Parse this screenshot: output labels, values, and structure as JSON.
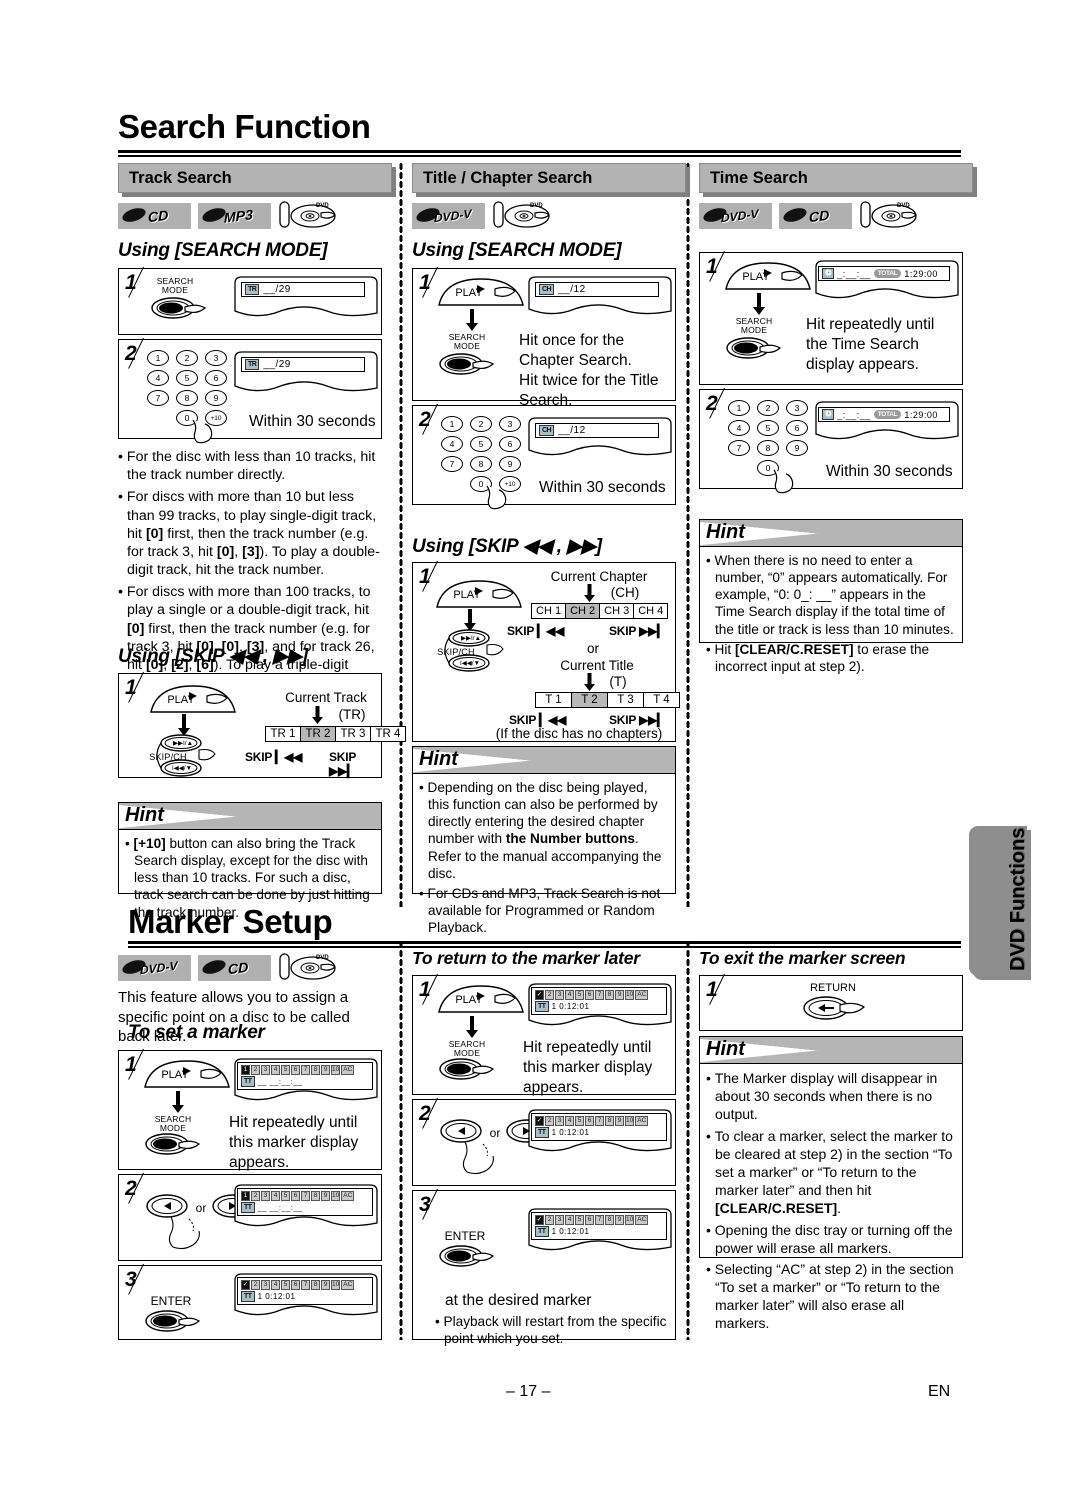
{
  "page": {
    "main_title": "Search Function",
    "second_title": "Marker Setup",
    "page_number": "– 17 –",
    "language_code": "EN",
    "side_tab": "DVD Functions"
  },
  "hint_label": "Hint",
  "track_search": {
    "section_title": "Track Search",
    "badges": [
      "CD",
      "MP3"
    ],
    "disc_icon": "dvd-disc-icon",
    "heading_search_mode": "Using [SEARCH MODE]",
    "heading_skip": "Using [SKIP ◀◀ , ▶▶]",
    "step1": {
      "number": "1",
      "button_label": "SEARCH\nMODE",
      "display_tag": "TR",
      "display_value": "__/29"
    },
    "step2": {
      "number": "2",
      "keys": [
        "1",
        "2",
        "3",
        "4",
        "5",
        "6",
        "7",
        "8",
        "9",
        "0",
        "+10"
      ],
      "display_tag": "TR",
      "display_value": "__/29",
      "caption": "Within 30 seconds"
    },
    "bullets": [
      "For the disc with less than 10 tracks, hit the track number directly.",
      "For discs with more than 10 but less than 99 tracks, to play single-digit track, hit [0] first, then the track number (e.g. for track 3, hit [0], [3]). To play a double-digit track, hit the track number.",
      "For discs with more than 100 tracks, to play a single or a double-digit track, hit [0] first, then the track number (e.g. for track 3, hit [0], [0], [3], and for track 26, hit [0], [2], [6]). To play a triple-digit track, hit the track number."
    ],
    "skip_step1": {
      "number": "1",
      "play_label": "PLAY",
      "skip_label": "SKIP/CH",
      "caption_top": "Current Track",
      "caption_unit": "(TR)",
      "cells": [
        "TR 1",
        "TR 2",
        "TR 3",
        "TR 4"
      ],
      "selected_index": 1,
      "skip_back": "SKIP ▎◀◀",
      "skip_fwd": "SKIP ▶▶▎"
    },
    "hint": [
      "[+10] button can also bring the Track Search display, except for the disc with less than 10 tracks. For such a disc, track search can be done by just hitting the track number."
    ]
  },
  "title_chapter_search": {
    "section_title": "Title / Chapter Search",
    "badges": [
      "DVD-V"
    ],
    "disc_icon": "dvd-disc-icon",
    "heading_search_mode": "Using [SEARCH MODE]",
    "heading_skip": "Using [SKIP ◀◀ , ▶▶]",
    "step1": {
      "number": "1",
      "play_label": "PLAY",
      "button_label": "SEARCH\nMODE",
      "display_tag": "CH",
      "display_value": "__/12",
      "caption": "Hit once for the Chapter Search.\nHit twice for the Title Search."
    },
    "step2": {
      "number": "2",
      "keys": [
        "1",
        "2",
        "3",
        "4",
        "5",
        "6",
        "7",
        "8",
        "9",
        "0",
        "+10"
      ],
      "display_tag": "CH",
      "display_value": "__/12",
      "caption": "Within 30 seconds"
    },
    "skip_step1": {
      "number": "1",
      "play_label": "PLAY",
      "skip_label": "SKIP/CH",
      "caption_chapter": "Current Chapter",
      "unit_chapter": "(CH)",
      "chapter_cells": [
        "CH 1",
        "CH 2",
        "CH 3",
        "CH 4"
      ],
      "chapter_selected": 1,
      "or_label": "or",
      "caption_title": "Current Title",
      "unit_title": "(T)",
      "title_cells": [
        "T 1",
        "T 2",
        "T 3",
        "T 4"
      ],
      "title_selected": 1,
      "skip_back": "SKIP ▎◀◀",
      "skip_fwd": "SKIP ▶▶▎",
      "footnote": "(If the disc has no chapters)"
    },
    "hint": [
      "Depending on the disc being played, this function can also be performed by directly entering the desired chapter number with <b>the Number buttons</b>. Refer to the manual accompanying the disc.",
      "For CDs and MP3, Track Search is not available for Programmed or Random Playback."
    ]
  },
  "time_search": {
    "section_title": "Time Search",
    "badges": [
      "DVD-V",
      "CD"
    ],
    "disc_icon": "dvd-disc-icon",
    "step1": {
      "number": "1",
      "play_label": "PLAY",
      "button_label": "SEARCH\nMODE",
      "display_tag": "clock-icon",
      "display_value": "_:__:__",
      "display_total_label": "TOTAL",
      "display_total_value": "1:29:00",
      "caption": "Hit repeatedly until the Time Search display appears."
    },
    "step2": {
      "number": "2",
      "keys": [
        "1",
        "2",
        "3",
        "4",
        "5",
        "6",
        "7",
        "8",
        "9",
        "0"
      ],
      "display_tag": "clock-icon",
      "display_value": "_:__:__",
      "display_total_label": "TOTAL",
      "display_total_value": "1:29:00",
      "caption": "Within 30 seconds"
    },
    "hint": [
      "When there is no need to enter a number, “0” appears automatically. For example, “0: 0_: __” appears in the Time Search display if the total time of the title or track is less than 10 minutes.",
      "Hit <b>[CLEAR/C.RESET]</b> to erase the incorrect input at step 2)."
    ]
  },
  "marker_setup": {
    "badges": [
      "DVD-V",
      "CD"
    ],
    "disc_icon": "dvd-disc-icon",
    "intro": "This feature allows you to assign a specific point on a disc to be called back later.",
    "to_set": {
      "heading": "To set a marker",
      "step1": {
        "number": "1",
        "play_label": "PLAY",
        "button_label": "SEARCH\nMODE",
        "marker_cells": [
          "1",
          "2",
          "3",
          "4",
          "5",
          "6",
          "7",
          "8",
          "9",
          "10"
        ],
        "marker_selected": 0,
        "marker_ac": "AC",
        "row2_tag": "TT",
        "row2_value": "__  __:__:__",
        "caption": "Hit repeatedly until this marker display appears."
      },
      "step2": {
        "number": "2",
        "left_icon": "arrow-left-button",
        "or_label": "or",
        "right_icon": "arrow-right-button",
        "marker_cells": [
          "1",
          "2",
          "3",
          "4",
          "5",
          "6",
          "7",
          "8",
          "9",
          "10"
        ],
        "marker_selected": 0,
        "marker_ac": "AC",
        "row2_tag": "TT",
        "row2_value": "__  __:__:__"
      },
      "step3": {
        "number": "3",
        "button_label": "ENTER",
        "marker_cells": [
          "✓",
          "2",
          "3",
          "4",
          "5",
          "6",
          "7",
          "8",
          "9",
          "10"
        ],
        "marker_selected": 0,
        "marker_ac": "AC",
        "row2_tag": "TT",
        "row2_value": "1  0:12:01"
      }
    },
    "to_return": {
      "heading": "To return to the marker later",
      "step1": {
        "number": "1",
        "play_label": "PLAY",
        "button_label": "SEARCH\nMODE",
        "marker_cells": [
          "✓",
          "2",
          "3",
          "4",
          "5",
          "6",
          "7",
          "8",
          "9",
          "10"
        ],
        "marker_selected": 0,
        "marker_ac": "AC",
        "row2_tag": "TT",
        "row2_value": "1  0:12:01",
        "caption": "Hit repeatedly until this marker display appears."
      },
      "step2": {
        "number": "2",
        "left_icon": "arrow-left-button",
        "or_label": "or",
        "right_icon": "arrow-right-button",
        "marker_cells": [
          "✓",
          "2",
          "3",
          "4",
          "5",
          "6",
          "7",
          "8",
          "9",
          "10"
        ],
        "marker_selected": 0,
        "marker_ac": "AC",
        "row2_tag": "TT",
        "row2_value": "1  0:12:01"
      },
      "step3": {
        "number": "3",
        "button_label": "ENTER",
        "marker_cells": [
          "✓",
          "2",
          "3",
          "4",
          "5",
          "6",
          "7",
          "8",
          "9",
          "10"
        ],
        "marker_selected": 0,
        "marker_ac": "AC",
        "row2_tag": "TT",
        "row2_value": "1  0:12:01",
        "caption": "at the desired marker",
        "note": "Playback will restart from the specific point which you set."
      }
    },
    "to_exit": {
      "heading": "To exit the marker screen",
      "step1": {
        "number": "1",
        "button_label": "RETURN"
      },
      "hint": [
        "The Marker display will disappear in about 30 seconds when there is no output.",
        "To clear a marker, select the marker to be cleared at step 2) in the section “To set a marker” or “To return to the marker later” and then hit <b>[CLEAR/C.RESET]</b>.",
        "Opening the disc tray or turning off the power will erase all markers.",
        "Selecting “AC” at step 2) in the section “To set a marker” or “To return to the marker later” will also erase all markers."
      ]
    }
  }
}
